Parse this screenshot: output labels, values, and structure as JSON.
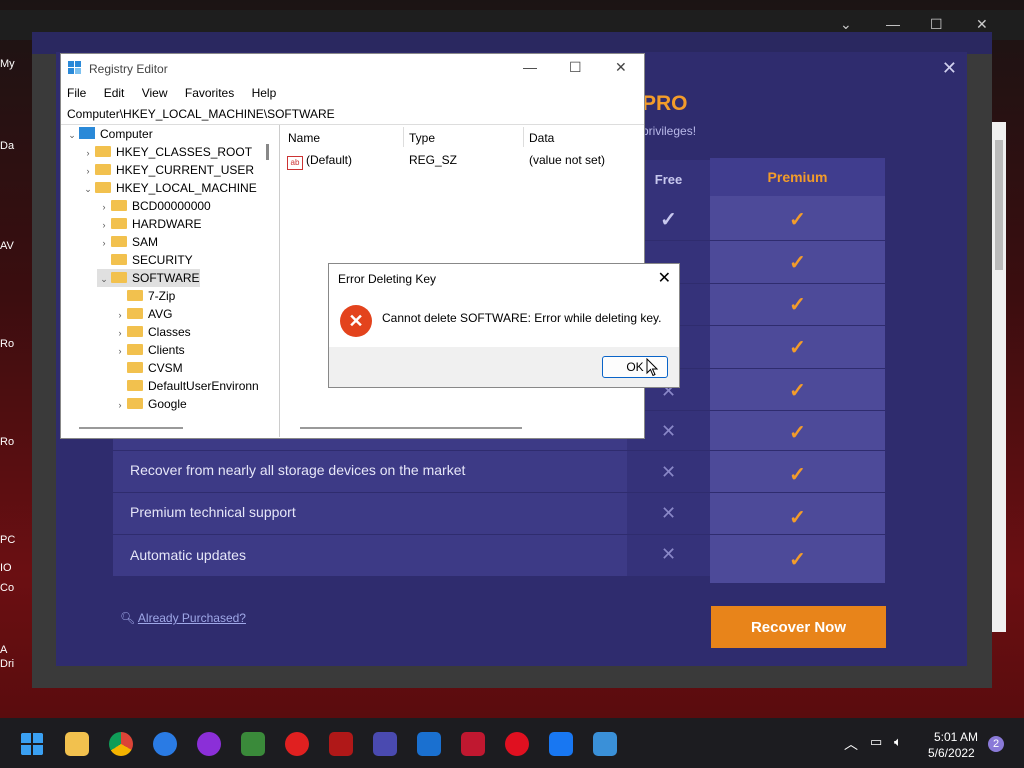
{
  "app": {
    "title_fragment": "PRO",
    "subtitle_fragment": "privileges!",
    "free_header": "Free",
    "premium_header": "Premium",
    "features": [
      "Recover from nearly all storage devices on the market",
      "Premium technical support",
      "Automatic updates"
    ],
    "already_purchased": "Already Purchased?",
    "recover_now": "Recover Now",
    "accent_color": "#f39c2a"
  },
  "registry": {
    "title": "Registry Editor",
    "menu": [
      "File",
      "Edit",
      "View",
      "Favorites",
      "Help"
    ],
    "address": "Computer\\HKEY_LOCAL_MACHINE\\SOFTWARE",
    "tree": [
      {
        "label": "Computer",
        "arrow": "⌄"
      },
      {
        "label": "HKEY_CLASSES_ROOT",
        "arrow": "›"
      },
      {
        "label": "HKEY_CURRENT_USER",
        "arrow": "›"
      },
      {
        "label": "HKEY_LOCAL_MACHINE",
        "arrow": "⌄"
      },
      {
        "label": "BCD00000000",
        "arrow": "›"
      },
      {
        "label": "HARDWARE",
        "arrow": "›"
      },
      {
        "label": "SAM",
        "arrow": "›"
      },
      {
        "label": "SECURITY",
        "arrow": ""
      },
      {
        "label": "SOFTWARE",
        "arrow": "⌄"
      },
      {
        "label": "7-Zip",
        "arrow": ""
      },
      {
        "label": "AVG",
        "arrow": "›"
      },
      {
        "label": "Classes",
        "arrow": "›"
      },
      {
        "label": "Clients",
        "arrow": "›"
      },
      {
        "label": "CVSM",
        "arrow": ""
      },
      {
        "label": "DefaultUserEnvironn",
        "arrow": ""
      },
      {
        "label": "Google",
        "arrow": "›"
      }
    ],
    "columns": [
      "Name",
      "Type",
      "Data"
    ],
    "values": [
      {
        "name": "(Default)",
        "type": "REG_SZ",
        "data": "(value not set)"
      }
    ]
  },
  "dialog": {
    "title": "Error Deleting Key",
    "message": "Cannot delete SOFTWARE:  Error while deleting key.",
    "ok": "OK"
  },
  "taskbar": {
    "time": "5:01 AM",
    "date": "5/6/2022",
    "notifications": "2"
  },
  "desktop": {
    "labels": [
      "My",
      "Da",
      "AV",
      "Ro",
      "Ro",
      "PC",
      "IO",
      "Co",
      "A",
      "Dri"
    ]
  }
}
